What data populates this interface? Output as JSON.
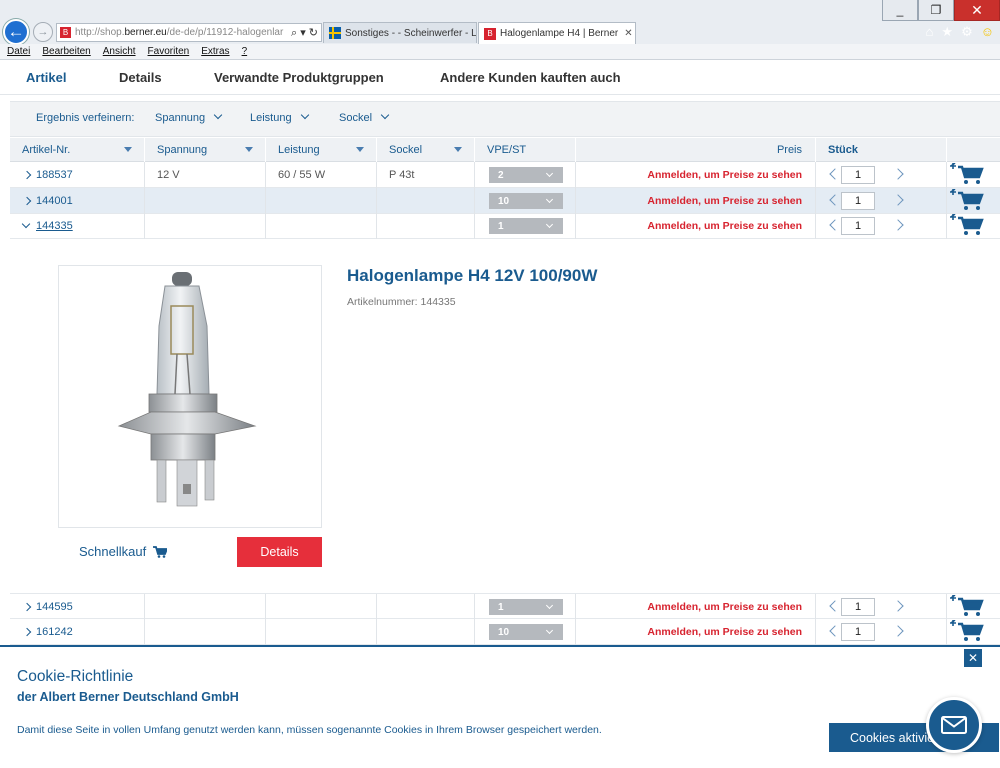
{
  "browser": {
    "address_url_prefix": "http://shop.",
    "address_url_domain": "berner.eu",
    "address_url_rest": "/de-de/p/11912-halogenlar",
    "address_tools": "⌕ ▾ ↻",
    "tabs": [
      {
        "title": "Sonstiges - - Scheinwerfer - Le...",
        "active": false
      },
      {
        "title": "Halogenlampe H4 | Berner",
        "active": true
      }
    ],
    "window_buttons": [
      "_",
      "❐",
      "✕"
    ],
    "right_icons": [
      "⌂",
      "★",
      "⚙",
      "☺"
    ],
    "menu": [
      "Datei",
      "Bearbeiten",
      "Ansicht",
      "Favoriten",
      "Extras",
      "?"
    ]
  },
  "page_tabs": [
    {
      "label": "Artikel",
      "active": true
    },
    {
      "label": "Details",
      "active": false
    },
    {
      "label": "Verwandte Produktgruppen",
      "active": false
    },
    {
      "label": "Andere Kunden kauften auch",
      "active": false
    }
  ],
  "filter": {
    "label": "Ergebnis verfeinern:",
    "items": [
      "Spannung",
      "Leistung",
      "Sockel"
    ]
  },
  "table": {
    "headers": [
      "Artikel-Nr.",
      "Spannung",
      "Leistung",
      "Sockel",
      "VPE/ST",
      "Preis",
      "Stück"
    ],
    "rows": [
      {
        "art": "188537",
        "spannung": "12 V",
        "leistung": "60 / 55 W",
        "sockel": "P 43t",
        "vpe": "2",
        "preis": "Anmelden, um Preise zu sehen",
        "qty": "1",
        "expanded": false
      },
      {
        "art": "144001",
        "spannung": "",
        "leistung": "",
        "sockel": "",
        "vpe": "10",
        "preis": "Anmelden, um Preise zu sehen",
        "qty": "1",
        "expanded": false
      },
      {
        "art": "144335",
        "spannung": "",
        "leistung": "",
        "sockel": "",
        "vpe": "1",
        "preis": "Anmelden, um Preise zu sehen",
        "qty": "1",
        "expanded": true
      }
    ],
    "rows_after": [
      {
        "art": "144595",
        "spannung": "",
        "leistung": "",
        "sockel": "",
        "vpe": "1",
        "preis": "Anmelden, um Preise zu sehen",
        "qty": "1",
        "expanded": false
      },
      {
        "art": "161242",
        "spannung": "",
        "leistung": "",
        "sockel": "",
        "vpe": "10",
        "preis": "Anmelden, um Preise zu sehen",
        "qty": "1",
        "expanded": false
      }
    ]
  },
  "detail": {
    "title": "Halogenlampe H4 12V 100/90W",
    "artikelnummer": "Artikelnummer: 144335",
    "quick_label": "Schnellkauf",
    "details_button": "Details"
  },
  "cookie": {
    "title": "Cookie-Richtlinie",
    "subtitle": "der Albert Berner Deutschland GmbH",
    "text": "Damit diese Seite in vollen Umfang genutzt werden kann, müssen sogenannte Cookies in Ihrem Browser gespeichert werden.",
    "button": "Cookies aktivieren",
    "close": "✕"
  },
  "colors": {
    "brand_blue": "#1a5b8f",
    "price_red": "#d7232f",
    "details_red": "#e62f3b"
  }
}
